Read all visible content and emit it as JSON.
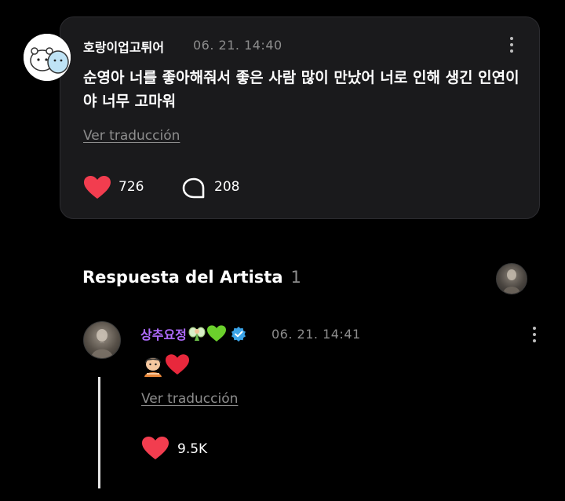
{
  "comment": {
    "username": "호랑이업고튀어",
    "timestamp": "06. 21. 14:40",
    "text": "순영아 너를 좋아해줘서 좋은 사람 많이 만났어 너로 인해 생긴 인연이야 너무 고마워",
    "translate_label": "Ver traducción",
    "likes": "726",
    "replies": "208"
  },
  "artist_section": {
    "title": "Respuesta del Artista",
    "count": "1"
  },
  "reply": {
    "username": "상추요정",
    "timestamp": "06. 21. 14:41",
    "translate_label": "Ver traducción",
    "likes": "9.5K"
  },
  "colors": {
    "background": "#000000",
    "card": "#1a1a1c",
    "like_red": "#f23d4f",
    "artist_name_purple": "#b06cff",
    "verified_badge": "#3aa3e8",
    "muted_text": "#8d8d8d"
  }
}
